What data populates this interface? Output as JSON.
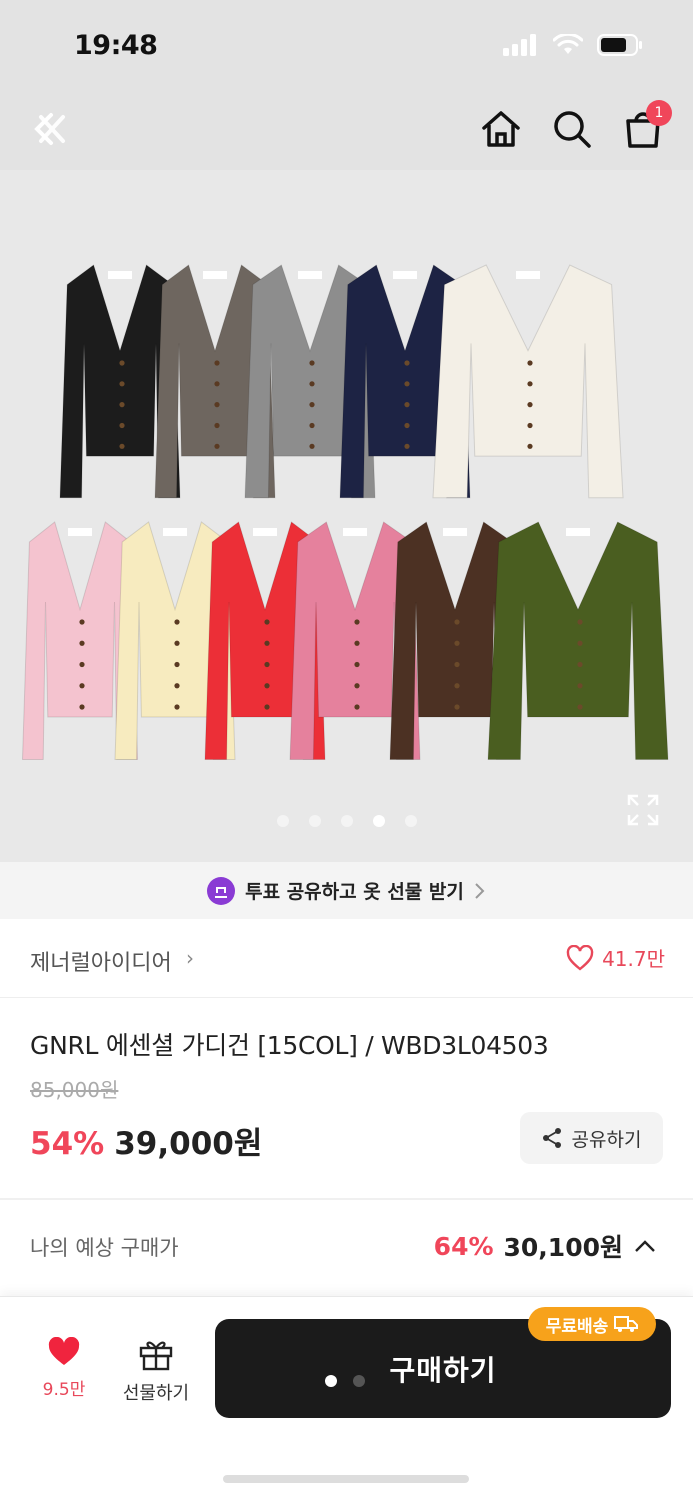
{
  "status_bar": {
    "time": "19:48"
  },
  "header": {
    "cart_count": "1"
  },
  "gallery": {
    "page_count": 5,
    "active_page": 4
  },
  "promo": {
    "vote_text": "투표 공유하고 옷 선물 받기"
  },
  "brand": {
    "name": "제너럴아이디어",
    "like_count": "41.7만"
  },
  "product": {
    "title": "GNRL 에센셜 가디건 [15COL] / WBD3L04503",
    "original_price": "85,000원",
    "discount": "54%",
    "price": "39,000원",
    "share_label": "공유하기"
  },
  "expected": {
    "label": "나의 예상 구매가",
    "discount": "64%",
    "price": "30,100원"
  },
  "bottom": {
    "wish_count": "9.5만",
    "gift_label": "선물하기",
    "buy_label": "구매하기",
    "free_shipping": "무료배송"
  },
  "colors": {
    "accent": "#f0465a",
    "buy_button": "#1b1b1b",
    "free_badge": "#f7a21b",
    "garments_top": [
      "#1c1c1c",
      "#6e665f",
      "#8d8d8d",
      "#1d2344",
      "#f3efe6"
    ],
    "garments_bottom": [
      "#f4c3cf",
      "#f7ebbf",
      "#ec2f37",
      "#e5819d",
      "#4c3123",
      "#4a5e20"
    ]
  }
}
